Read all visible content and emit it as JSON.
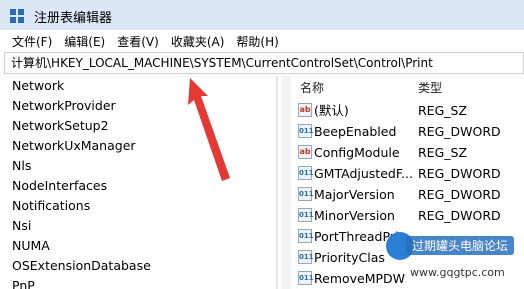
{
  "window": {
    "title": "注册表编辑器"
  },
  "menu": [
    "文件(F)",
    "编辑(E)",
    "查看(V)",
    "收藏夹(A)",
    "帮助(H)"
  ],
  "address": "计算机\\HKEY_LOCAL_MACHINE\\SYSTEM\\CurrentControlSet\\Control\\Print",
  "tree": [
    "Network",
    "NetworkProvider",
    "NetworkSetup2",
    "NetworkUxManager",
    "Nls",
    "NodeInterfaces",
    "Notifications",
    "Nsi",
    "NUMA",
    "OSExtensionDatabase",
    "PnP"
  ],
  "values_header": {
    "name": "名称",
    "type": "类型"
  },
  "values": [
    {
      "icon": "string-value-icon",
      "name": "(默认)",
      "type": "REG_SZ"
    },
    {
      "icon": "binary-value-icon",
      "name": "BeepEnabled",
      "type": "REG_DWORD"
    },
    {
      "icon": "string-value-icon",
      "name": "ConfigModule",
      "type": "REG_SZ"
    },
    {
      "icon": "binary-value-icon",
      "name": "GMTAdjustedF...",
      "type": "REG_DWORD"
    },
    {
      "icon": "binary-value-icon",
      "name": "MajorVersion",
      "type": "REG_DWORD"
    },
    {
      "icon": "binary-value-icon",
      "name": "MinorVersion",
      "type": "REG_DWORD"
    },
    {
      "icon": "binary-value-icon",
      "name": "PortThreadPri",
      "type": ""
    },
    {
      "icon": "binary-value-icon",
      "name": "PriorityClas",
      "type": ""
    },
    {
      "icon": "binary-value-icon",
      "name": "RemoveMPDW",
      "type": ""
    }
  ],
  "watermark": {
    "text": "过期罐头电脑论坛",
    "url": "www.gqgtpc.com"
  },
  "colors": {
    "titlebar": "#dbe7f5",
    "arrow": "#e53935",
    "watermark": "#2a7fd4"
  }
}
